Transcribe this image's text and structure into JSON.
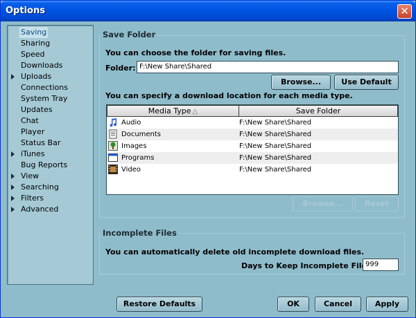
{
  "window": {
    "title": "Options",
    "close_glyph": "✕"
  },
  "sidebar": {
    "items": [
      {
        "label": "Saving",
        "expandable": false,
        "selected": true
      },
      {
        "label": "Sharing",
        "expandable": false
      },
      {
        "label": "Speed",
        "expandable": false
      },
      {
        "label": "Downloads",
        "expandable": false
      },
      {
        "label": "Uploads",
        "expandable": true
      },
      {
        "label": "Connections",
        "expandable": false
      },
      {
        "label": "System Tray",
        "expandable": false
      },
      {
        "label": "Updates",
        "expandable": false
      },
      {
        "label": "Chat",
        "expandable": false
      },
      {
        "label": "Player",
        "expandable": false
      },
      {
        "label": "Status Bar",
        "expandable": false
      },
      {
        "label": "iTunes",
        "expandable": true
      },
      {
        "label": "Bug Reports",
        "expandable": false
      },
      {
        "label": "View",
        "expandable": true
      },
      {
        "label": "Searching",
        "expandable": true
      },
      {
        "label": "Filters",
        "expandable": true
      },
      {
        "label": "Advanced",
        "expandable": true
      }
    ]
  },
  "save_folder": {
    "title": "Save Folder",
    "description": "You can choose the folder for saving files.",
    "folder_label": "Folder:",
    "folder_value": "F:\\New Share\\Shared",
    "browse_label": "Browse...",
    "use_default_label": "Use Default",
    "media_description": "You can specify a download location for each media type.",
    "table": {
      "headers": [
        "Media Type",
        "Save Folder"
      ],
      "sort_glyph": "△",
      "rows": [
        {
          "type": "Audio",
          "icon": "audio-icon",
          "folder": "F:\\New Share\\Shared"
        },
        {
          "type": "Documents",
          "icon": "document-icon",
          "folder": "F:\\New Share\\Shared"
        },
        {
          "type": "Images",
          "icon": "image-icon",
          "folder": "F:\\New Share\\Shared"
        },
        {
          "type": "Programs",
          "icon": "program-icon",
          "folder": "F:\\New Share\\Shared"
        },
        {
          "type": "Video",
          "icon": "video-icon",
          "folder": "F:\\New Share\\Shared"
        }
      ]
    },
    "table_browse_label": "Browse...",
    "table_reset_label": "Reset"
  },
  "incomplete": {
    "title": "Incomplete Files",
    "description": "You can automatically delete old incomplete download files.",
    "days_label": "Days to Keep Incomplete Files:",
    "days_value": "999"
  },
  "footer": {
    "restore_label": "Restore Defaults",
    "ok_label": "OK",
    "cancel_label": "Cancel",
    "apply_label": "Apply"
  },
  "colors": {
    "titlebar": "#0054e3",
    "background": "#8fbccb",
    "sidebar": "#a5cad6",
    "selected": "#c8e1ea"
  }
}
